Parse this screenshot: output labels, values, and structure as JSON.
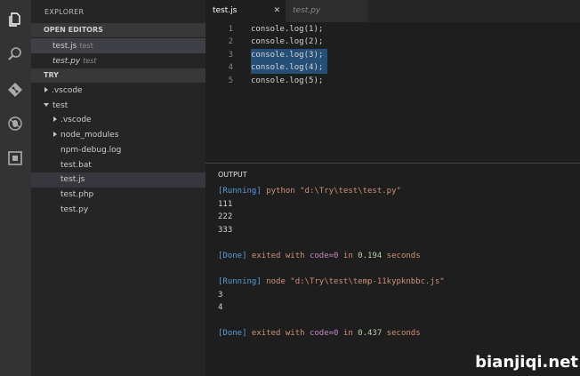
{
  "colors": {
    "accent": "#007acc",
    "selection": "#264f78",
    "output_keyword": "#569cd6",
    "output_string": "#ce9178",
    "output_purple": "#c586c0"
  },
  "activity_bar": {
    "icons": [
      "files-icon",
      "search-icon",
      "git-icon",
      "debug-icon",
      "extensions-icon"
    ]
  },
  "sidebar": {
    "title": "EXPLORER",
    "open_editors": {
      "header": "OPEN EDITORS",
      "items": [
        {
          "name": "test.js",
          "folder": "test"
        },
        {
          "name": "test.py",
          "folder": "test"
        }
      ]
    },
    "folder": {
      "header": "TRY",
      "items": [
        {
          "label": ".vscode"
        },
        {
          "label": "test"
        },
        {
          "label": ".vscode"
        },
        {
          "label": "node_modules"
        },
        {
          "label": "npm-debug.log"
        },
        {
          "label": "test.bat"
        },
        {
          "label": "test.js"
        },
        {
          "label": "test.php"
        },
        {
          "label": "test.py"
        }
      ]
    }
  },
  "tabs": [
    {
      "label": "test.js",
      "close": "✕"
    },
    {
      "label": "test.py"
    }
  ],
  "editor": {
    "lines": [
      {
        "num": "1",
        "text": "console.log(1);"
      },
      {
        "num": "2",
        "text": "console.log(2);"
      },
      {
        "num": "3",
        "text": "console.log(3);"
      },
      {
        "num": "4",
        "text": "console.log(4);"
      },
      {
        "num": "5",
        "text": "console.log(5);"
      }
    ]
  },
  "panel": {
    "title": "OUTPUT",
    "run1": {
      "tag": "[Running]",
      "cmd": " python \"d:\\Try\\test\\test.py\""
    },
    "out1": [
      "111",
      "222",
      "333"
    ],
    "done1": {
      "tag": "[Done]",
      "pre": " exited with ",
      "code": "code=0",
      "mid": " in ",
      "time": "0.194",
      "post": " seconds"
    },
    "run2": {
      "tag": "[Running]",
      "cmd": " node \"d:\\Try\\test\\temp-11kypknbbc.js\""
    },
    "out2": [
      "3",
      "4"
    ],
    "done2": {
      "tag": "[Done]",
      "pre": " exited with ",
      "code": "code=0",
      "mid": " in ",
      "time": "0.437",
      "post": " seconds"
    }
  },
  "watermark": "bianjiqi.net"
}
